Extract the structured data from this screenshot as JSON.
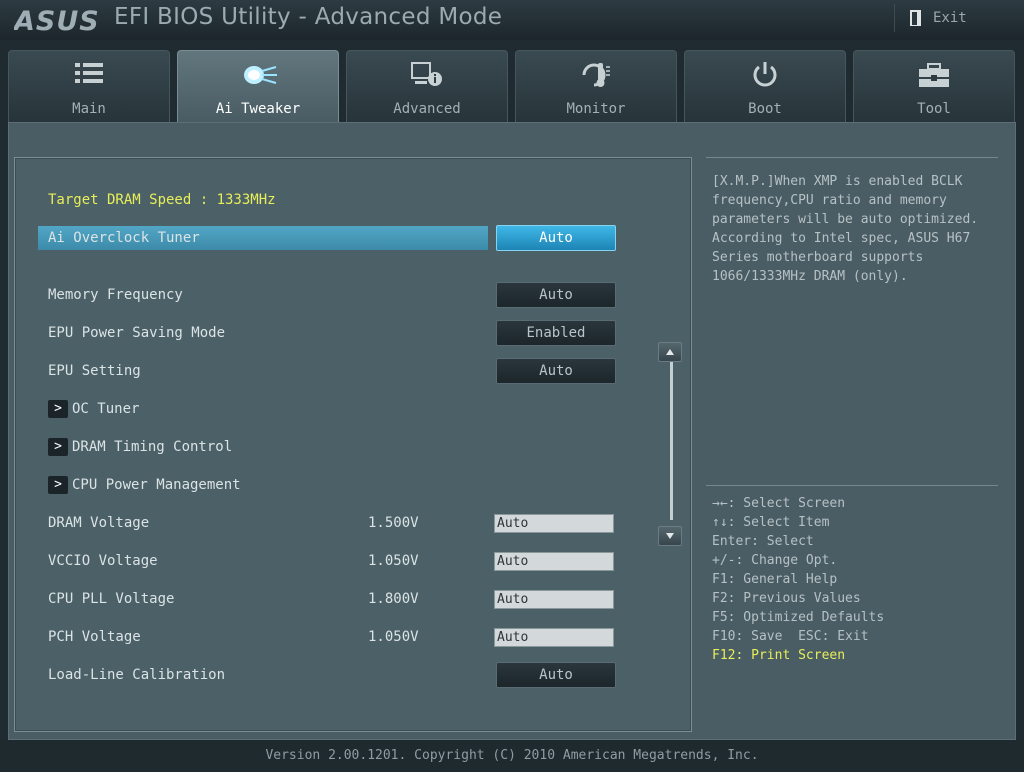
{
  "header": {
    "brand": "ASUS",
    "title": "EFI BIOS Utility - Advanced Mode",
    "exit_label": "Exit"
  },
  "tabs": [
    {
      "label": "Main",
      "icon": "list-icon",
      "active": false
    },
    {
      "label": "Ai Tweaker",
      "icon": "tweaker-icon",
      "active": true
    },
    {
      "label": "Advanced",
      "icon": "advanced-icon",
      "active": false
    },
    {
      "label": "Monitor",
      "icon": "thermometer-icon",
      "active": false
    },
    {
      "label": "Boot",
      "icon": "power-icon",
      "active": false
    },
    {
      "label": "Tool",
      "icon": "toolbox-icon",
      "active": false
    }
  ],
  "main": {
    "target_dram_speed": "Target DRAM Speed : 1333MHz",
    "ai_overclock_tuner": {
      "label": "Ai Overclock Tuner",
      "value": "Auto"
    },
    "memory_frequency": {
      "label": "Memory Frequency",
      "value": "Auto"
    },
    "epu_power_saving": {
      "label": "EPU Power Saving Mode",
      "value": "Enabled"
    },
    "epu_setting": {
      "label": "EPU Setting",
      "value": "Auto"
    },
    "submenus": {
      "oc_tuner": "OC Tuner",
      "dram_timing": "DRAM Timing Control",
      "cpu_power": "CPU Power Management"
    },
    "submenu_arrow": ">",
    "voltages": {
      "dram": {
        "label": "DRAM Voltage",
        "reading": "1.500V",
        "value": "Auto"
      },
      "vccio": {
        "label": "VCCIO Voltage",
        "reading": "1.050V",
        "value": "Auto"
      },
      "cpu_pll": {
        "label": "CPU PLL Voltage",
        "reading": "1.800V",
        "value": "Auto"
      },
      "pch": {
        "label": "PCH Voltage",
        "reading": "1.050V",
        "value": "Auto"
      }
    },
    "load_line": {
      "label": "Load-Line Calibration",
      "value": "Auto"
    }
  },
  "help": {
    "description": "[X.M.P.]When XMP is enabled BCLK\nfrequency,CPU ratio and memory\nparameters will be auto optimized.\nAccording to Intel spec, ASUS H67\nSeries motherboard supports\n1066/1333MHz DRAM (only).",
    "keys": {
      "select_screen": "→←: Select Screen",
      "select_item": "↑↓: Select Item",
      "enter": "Enter: Select",
      "change_opt": "+/-: Change Opt.",
      "f1": "F1: General Help",
      "f2": "F2: Previous Values",
      "f5": "F5: Optimized Defaults",
      "f10": "F10: Save  ESC: Exit",
      "f12": "F12: Print Screen"
    }
  },
  "footer": {
    "version": "Version 2.00.1201. Copyright (C) 2010 American Megatrends, Inc."
  },
  "colors": {
    "accent": "#3fb8e8",
    "highlight_text": "#e8ee5a"
  }
}
